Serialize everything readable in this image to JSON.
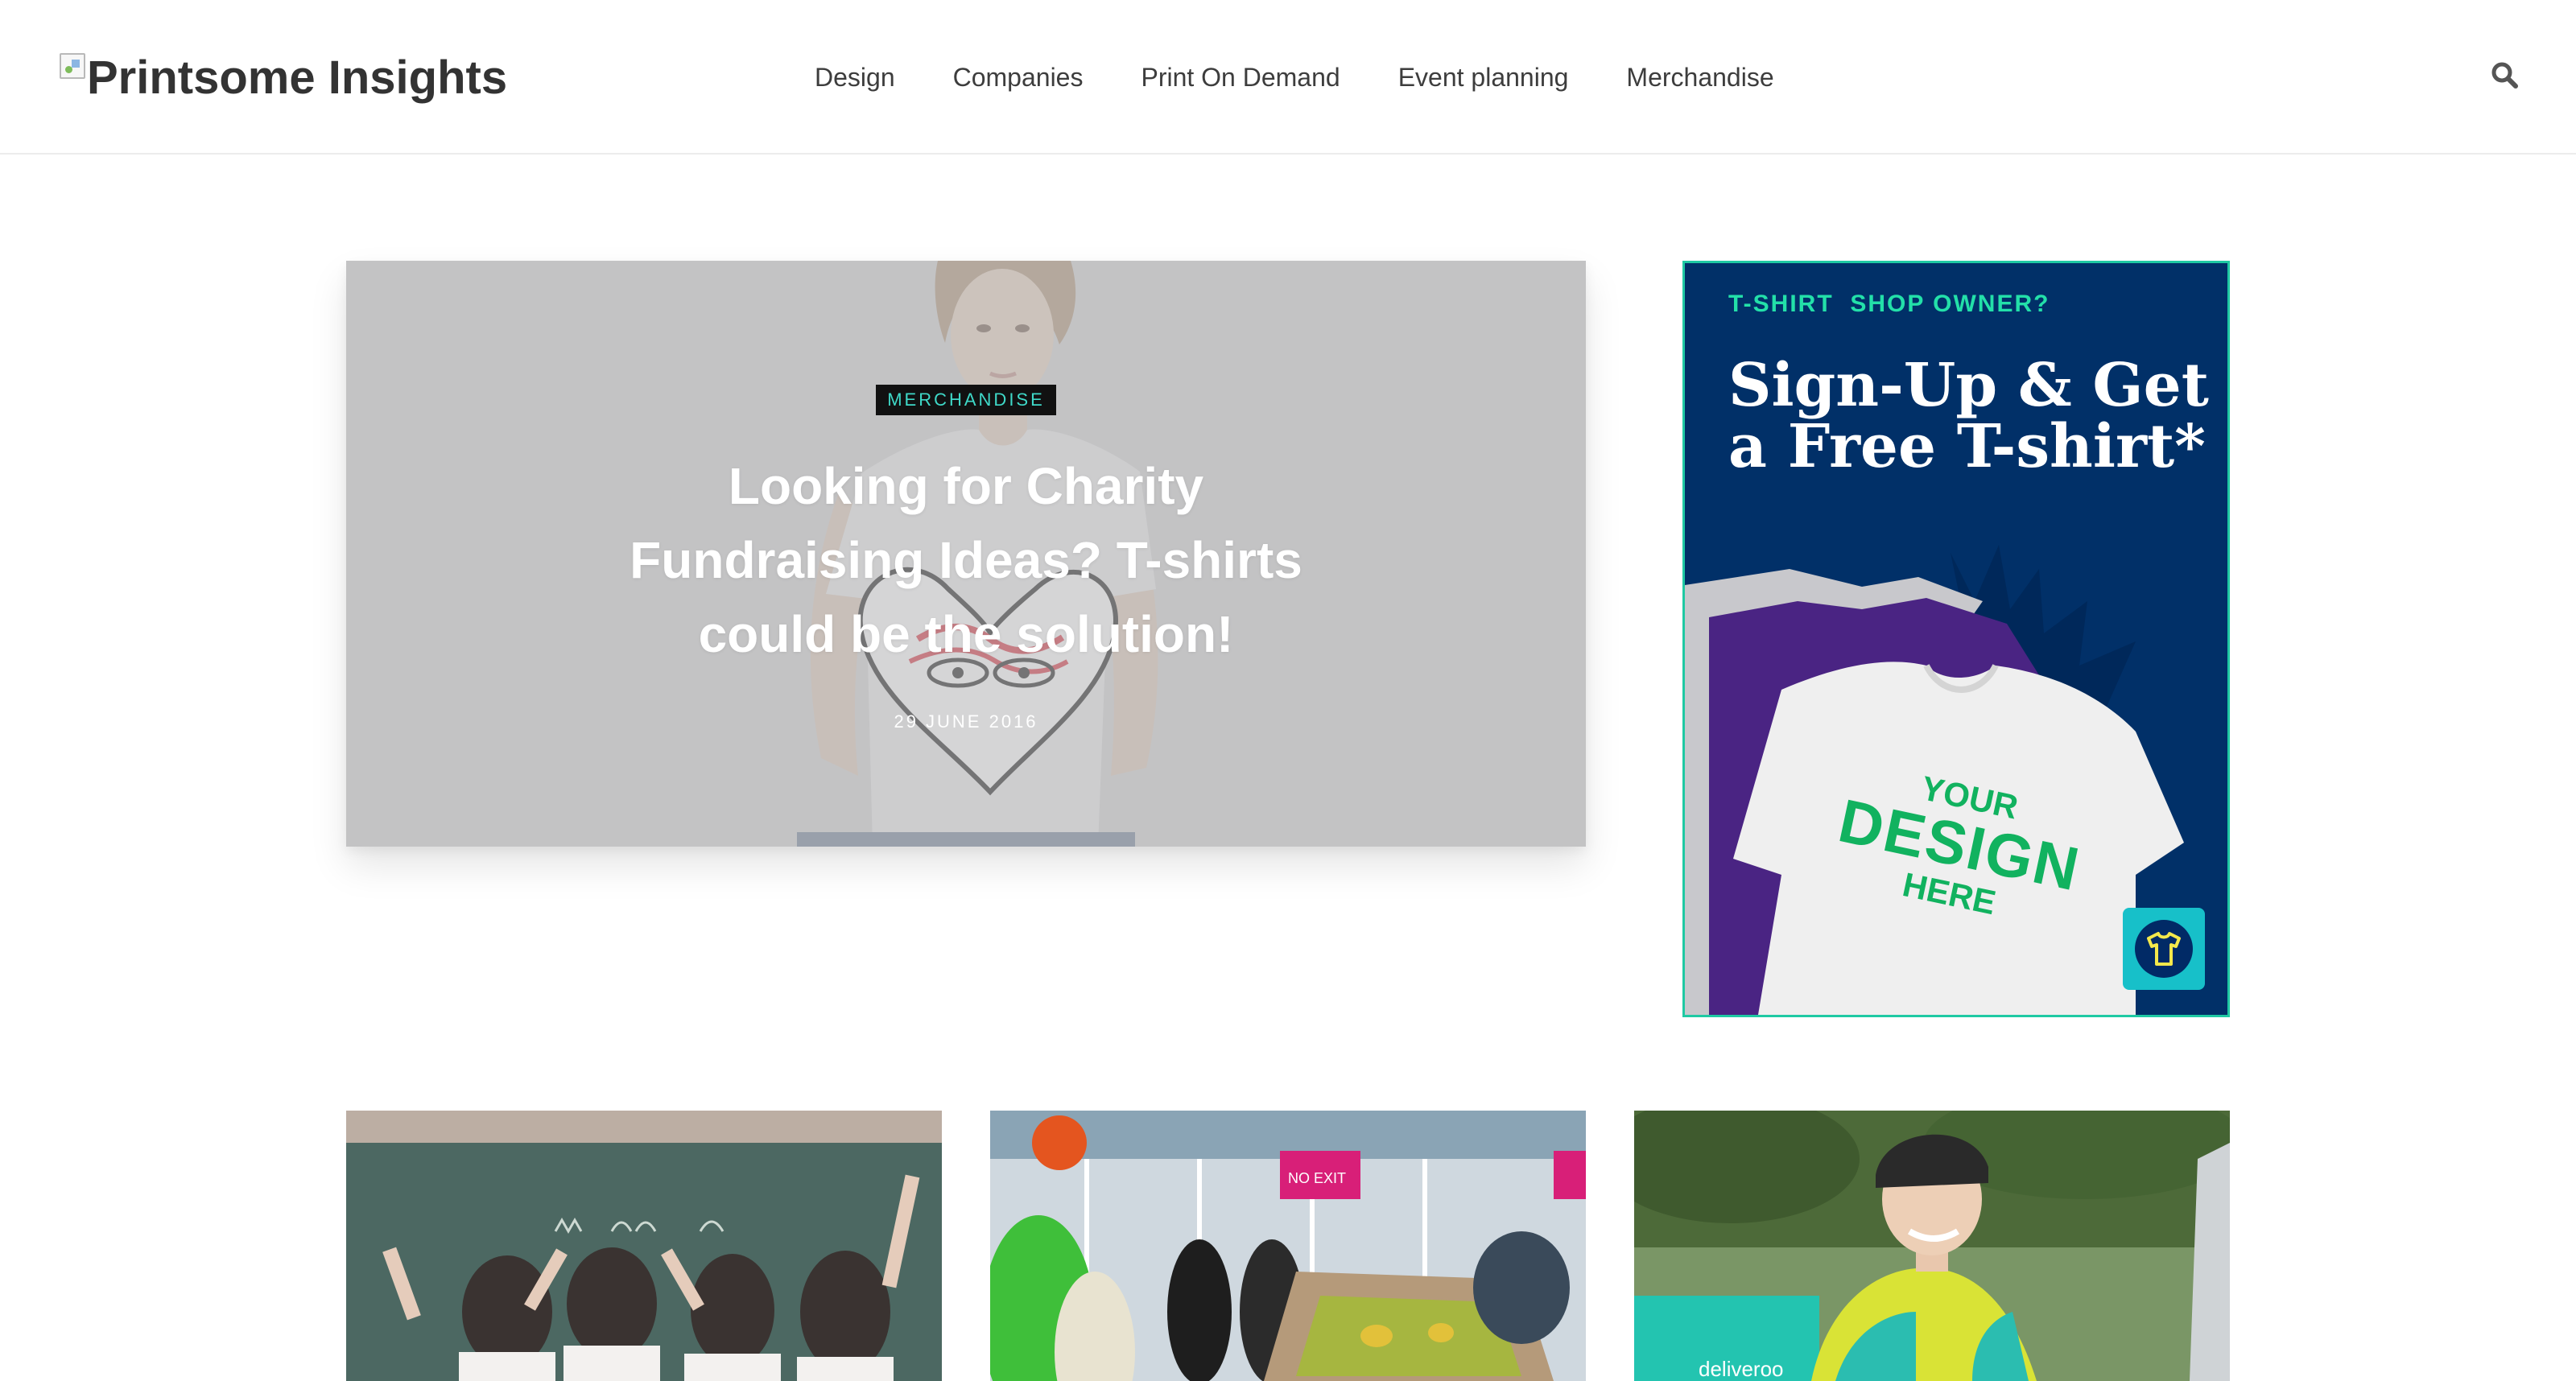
{
  "header": {
    "logo_text": "Printsome Insights",
    "nav": [
      "Design",
      "Companies",
      "Print On Demand",
      "Event planning",
      "Merchandise"
    ],
    "search_icon": "search-icon"
  },
  "hero": {
    "category": "MERCHANDISE",
    "title": "Looking for Charity Fundraising Ideas? T-shirts could be the solution!",
    "date": "29 JUNE 2016"
  },
  "ad": {
    "kicker": "T-SHIRT  SHOP OWNER?",
    "headline": "Sign-Up & Get a Free T-shirt*",
    "tshirt_text": [
      "YOUR",
      "DESIGN",
      "HERE"
    ],
    "logo_icon": "tshirt-icon"
  },
  "cards": [
    {
      "image": "students-chalkboard-photo"
    },
    {
      "image": "screen-printing-event-photo"
    },
    {
      "image": "deliveroo-cyclist-photo"
    }
  ],
  "colors": {
    "accent_teal": "#3fd9c8",
    "ad_navy": "#013068",
    "ad_green": "#23e0a9",
    "text_dark": "#333333"
  }
}
